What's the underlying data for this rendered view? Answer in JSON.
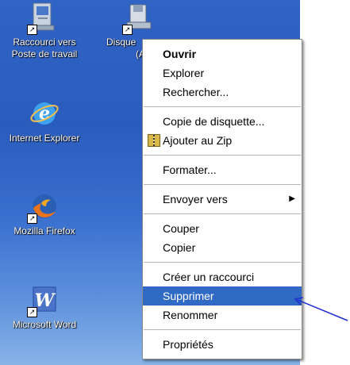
{
  "desktop": {
    "icons": [
      {
        "label_line1": "Raccourci vers",
        "label_line2": "Poste de travail"
      },
      {
        "label_line1": "Disque",
        "label_line2": "(A"
      },
      {
        "label_line1": "Internet Explorer"
      },
      {
        "label_line1": "Mozilla Firefox"
      },
      {
        "label_line1": "Microsoft Word"
      }
    ]
  },
  "context_menu": {
    "items": {
      "ouvrir": "Ouvrir",
      "explorer": "Explorer",
      "rechercher": "Rechercher...",
      "copie_disquette": "Copie de disquette...",
      "ajouter_zip": "Ajouter au Zip",
      "formater": "Formater...",
      "envoyer_vers": "Envoyer vers",
      "couper": "Couper",
      "copier": "Copier",
      "creer_raccourci": "Créer un raccourci",
      "supprimer": "Supprimer",
      "renommer": "Renommer",
      "proprietes": "Propriétés"
    },
    "highlighted_item": "Supprimer",
    "highlight_color": "#316ac5"
  },
  "colors": {
    "desktop_blue": "#2f63c4",
    "annotation_arrow": "#1f2fd0"
  },
  "icons": {
    "my_computer": "computer-icon",
    "floppy": "floppy-drive-icon",
    "ie": "internet-explorer-icon",
    "firefox": "firefox-icon",
    "word": "word-icon",
    "zip": "winzip-icon",
    "submenu": "triangle-right-icon",
    "arrow": "annotation-arrow-icon"
  }
}
